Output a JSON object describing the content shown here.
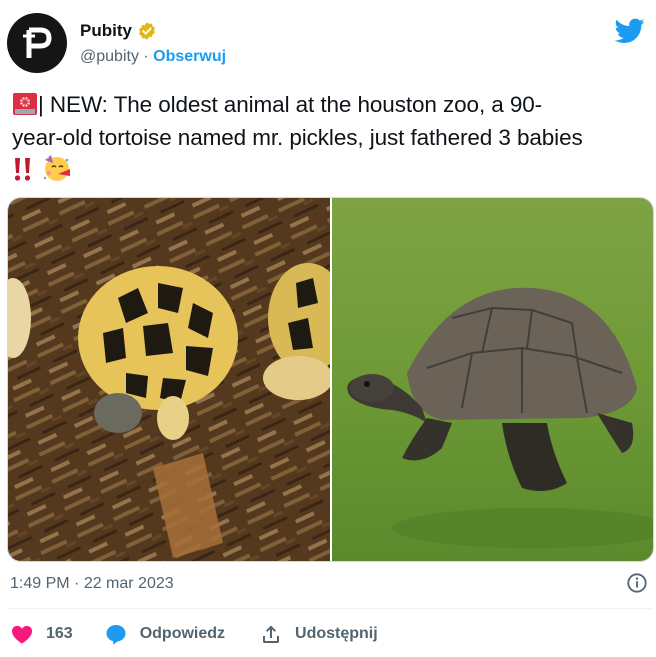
{
  "author": {
    "display_name": "Pubity",
    "handle": "@pubity",
    "separator": " · ",
    "follow_label": "Obserwuj"
  },
  "tweet": {
    "line1": "| NEW: The oldest animal at the houston zoo, a 90-",
    "line2": "year-old tortoise named mr. pickles, just fathered 3 babies"
  },
  "meta": {
    "time": "1:49 PM",
    "separator": " · ",
    "date": "22 mar 2023"
  },
  "actions": {
    "like_count": "163",
    "reply_label": "Odpowiedz",
    "share_label": "Udostępnij"
  },
  "icons": [
    "avatar-logo",
    "verified-badge-icon",
    "twitter-bird-icon",
    "siren-icon",
    "double-exclamation-icon",
    "party-face-icon",
    "info-icon",
    "heart-icon",
    "reply-bubble-icon",
    "share-icon"
  ],
  "colors": {
    "accent": "#1d9bf0",
    "like": "#f91880",
    "text": "#0f1419",
    "secondary": "#536471",
    "verified": "#e2b719"
  }
}
